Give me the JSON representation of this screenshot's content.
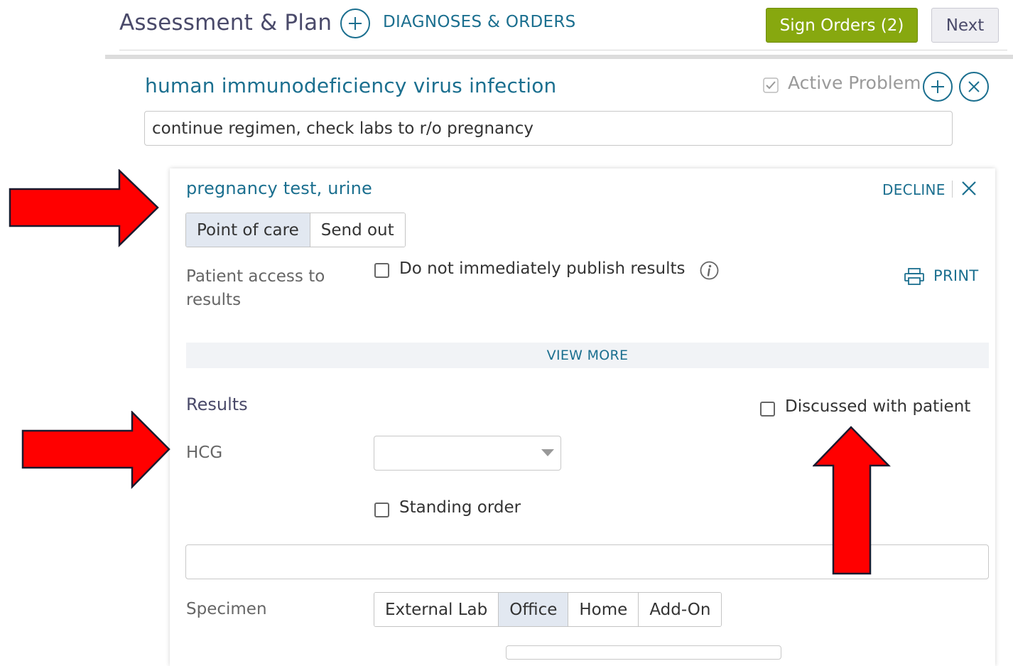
{
  "header": {
    "title": "Assessment & Plan",
    "diagnoses_orders_label": "DIAGNOSES & ORDERS",
    "sign_orders_label": "Sign Orders (2)",
    "next_label": "Next"
  },
  "problem": {
    "title": "human immunodeficiency virus infection",
    "active_problem_label": "Active Problem",
    "active_problem_checked": true,
    "note_value": "continue regimen, check labs to r/o pregnancy"
  },
  "order": {
    "title": "pregnancy test, urine",
    "decline_label": "DECLINE",
    "location_options": [
      "Point of care",
      "Send out"
    ],
    "location_selected": "Point of care",
    "patient_access_label": "Patient access to results",
    "publish_label": "Do not immediately publish results",
    "print_label": "PRINT",
    "view_more_label": "VIEW MORE",
    "results_label": "Results",
    "discussed_label": "Discussed with patient",
    "hcg_label": "HCG",
    "hcg_value": "",
    "standing_order_label": "Standing order",
    "comment_value": "",
    "specimen_label": "Specimen",
    "specimen_options": [
      "External Lab",
      "Office",
      "Home",
      "Add-On"
    ],
    "specimen_selected": "Office"
  },
  "colors": {
    "accent": "#1b6f8f",
    "sign_button": "#87a80f",
    "annotation_arrow": "#ff0000"
  },
  "icons": [
    "add-circle-icon",
    "close-circle-icon",
    "checkmark-icon",
    "close-icon",
    "info-icon",
    "printer-icon",
    "chevron-down-icon",
    "red-arrow-right",
    "red-arrow-up"
  ]
}
